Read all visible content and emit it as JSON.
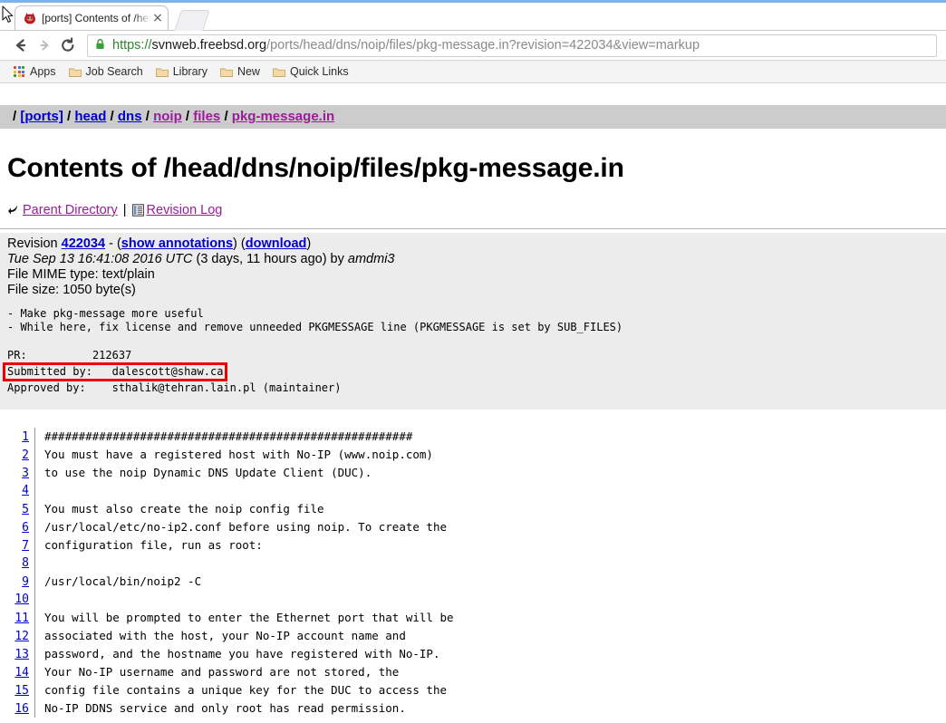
{
  "browser": {
    "tab": {
      "title": "[ports] Contents of /head/",
      "favicon": "freebsd-beastie-icon",
      "close_label": "×"
    },
    "toolbar": {
      "back_icon": "back-arrow-icon",
      "forward_icon": "forward-arrow-icon",
      "reload_icon": "reload-icon",
      "lock_icon": "https-lock-icon",
      "url": {
        "scheme": "https://",
        "host": "svnweb.freebsd.org",
        "rest": "/ports/head/dns/noip/files/pkg-message.in?revision=422034&view=markup",
        "full": "https://svnweb.freebsd.org/ports/head/dns/noip/files/pkg-message.in?revision=422034&view=markup"
      }
    },
    "bookmarks": [
      {
        "label": "Apps",
        "icon": "apps-grid-icon"
      },
      {
        "label": "Job Search",
        "icon": "folder-icon"
      },
      {
        "label": "Library",
        "icon": "folder-icon"
      },
      {
        "label": "New",
        "icon": "folder-icon"
      },
      {
        "label": "Quick Links",
        "icon": "folder-icon"
      }
    ]
  },
  "page": {
    "breadcrumb": {
      "lead": "/",
      "items": [
        {
          "label": "[ports]",
          "state": "unvisited"
        },
        {
          "label": "head",
          "state": "unvisited"
        },
        {
          "label": "dns",
          "state": "unvisited"
        },
        {
          "label": "noip",
          "state": "visited"
        },
        {
          "label": "files",
          "state": "visited"
        },
        {
          "label": "pkg-message.in",
          "state": "visited"
        }
      ],
      "separator": "/"
    },
    "title": "Contents of /head/dns/noip/files/pkg-message.in",
    "nav_links": {
      "parent_directory": "Parent Directory",
      "parent_icon": "parent-directory-icon",
      "separator": "|",
      "revision_log": "Revision Log",
      "revision_log_icon": "revision-log-icon"
    },
    "revision_info": {
      "revision_label": "Revision",
      "revision_number": "422034",
      "dash": "-",
      "show_annotations": "show annotations",
      "download": "download",
      "date": "Tue Sep 13 16:41:08 2016 UTC",
      "relative_time": "(3 days, 11 hours ago) by",
      "author": "amdmi3",
      "mime_type": "File MIME type: text/plain",
      "file_size": "File size: 1050 byte(s)"
    },
    "commit_message": {
      "line1": "- Make pkg-message more useful",
      "line2": "- While here, fix license and remove unneeded PKGMESSAGE line (PKGMESSAGE is set by SUB_FILES)",
      "line3": "",
      "pr_label": "PR:",
      "pr_value": "212637",
      "submitted_label": "Submitted by:",
      "submitted_value": "dalescott@shaw.ca",
      "approved_label": "Approved by:",
      "approved_value": "sthalik@tehran.lain.pl (maintainer)",
      "highlight_color": "#ee0000"
    },
    "source_lines": [
      {
        "n": "1",
        "text": "######################################################"
      },
      {
        "n": "2",
        "text": "You must have a registered host with No-IP (www.noip.com)"
      },
      {
        "n": "3",
        "text": "to use the noip Dynamic DNS Update Client (DUC)."
      },
      {
        "n": "4",
        "text": ""
      },
      {
        "n": "5",
        "text": "You must also create the noip config file"
      },
      {
        "n": "6",
        "text": "/usr/local/etc/no-ip2.conf before using noip. To create the"
      },
      {
        "n": "7",
        "text": "configuration file, run as root:"
      },
      {
        "n": "8",
        "text": ""
      },
      {
        "n": "9",
        "text": "/usr/local/bin/noip2 -C"
      },
      {
        "n": "10",
        "text": ""
      },
      {
        "n": "11",
        "text": "You will be prompted to enter the Ethernet port that will be"
      },
      {
        "n": "12",
        "text": "associated with the host, your No-IP account name and"
      },
      {
        "n": "13",
        "text": "password, and the hostname you have registered with No-IP."
      },
      {
        "n": "14",
        "text": "Your No-IP username and password are not stored, the"
      },
      {
        "n": "15",
        "text": "config file contains a unique key for the DUC to access the"
      },
      {
        "n": "16",
        "text": "No-IP DDNS service and only root has read permission."
      }
    ]
  },
  "colors": {
    "link_unvisited": "#0000cc",
    "link_visited": "#9b1b9b",
    "breadcrumb_bg": "#cccccc",
    "meta_bg": "#ececec",
    "annotation_red": "#ee0000",
    "top_accent": "#7fb2e5"
  }
}
